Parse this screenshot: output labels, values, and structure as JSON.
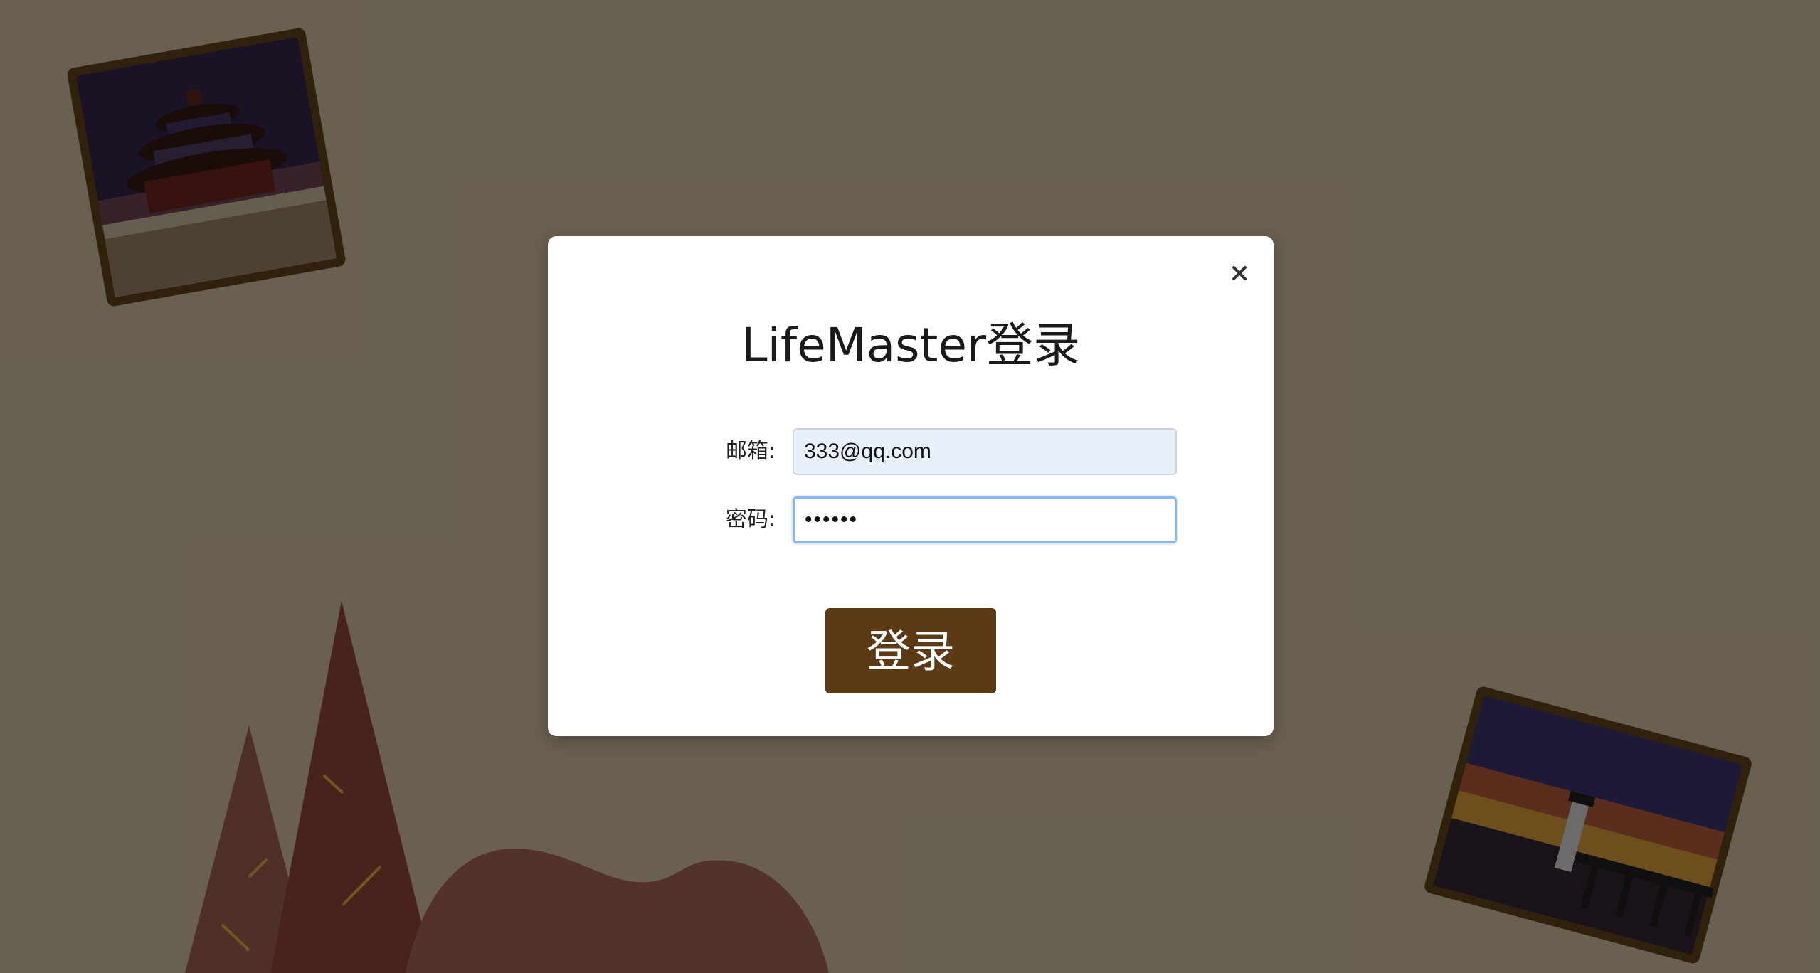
{
  "modal": {
    "title": "LifeMaster登录",
    "close_icon": "close-icon",
    "email_label": "邮箱:",
    "email_value": "333@qq.com",
    "password_label": "密码:",
    "password_value": "••••••",
    "login_label": "登录"
  },
  "colors": {
    "background": "#e8d6b0",
    "overlay": "rgba(0,0,0,0.55)",
    "button": "#5c3a16",
    "input_filled": "#e8f0fe",
    "focus_border": "#8ab6f5"
  }
}
